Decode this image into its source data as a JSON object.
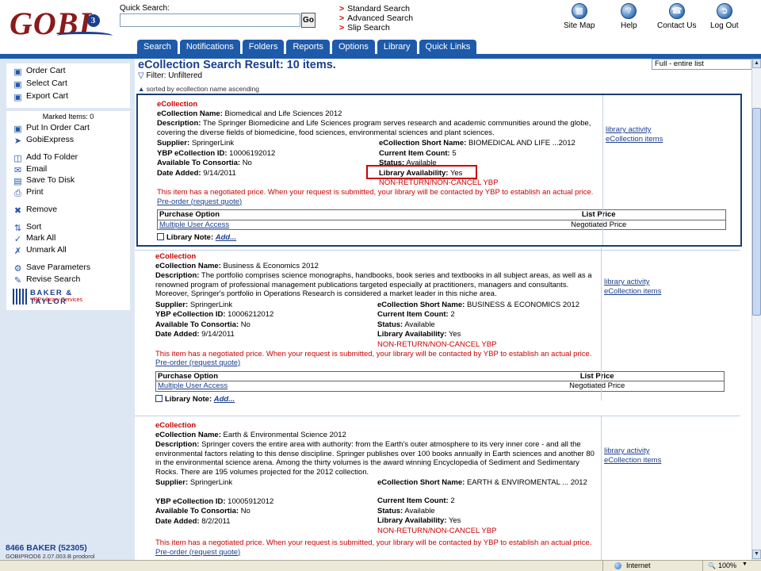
{
  "header": {
    "logo_text": "GOBI",
    "logo_version": "3",
    "quick_search_label": "Quick Search:",
    "quick_search_value": "",
    "go_label": "Go",
    "search_links": [
      "Standard Search",
      "Advanced Search",
      "Slip Search"
    ],
    "utility_icons": [
      {
        "label": "Site Map",
        "icon": "sitemap-icon"
      },
      {
        "label": "Help",
        "icon": "help-icon"
      },
      {
        "label": "Contact Us",
        "icon": "contact-icon"
      },
      {
        "label": "Log Out",
        "icon": "logout-icon"
      }
    ]
  },
  "tabs": [
    "Search",
    "Notifications",
    "Folders",
    "Reports",
    "Options",
    "Library",
    "Quick Links"
  ],
  "sidebar": {
    "cart_actions": [
      {
        "label": "Order Cart",
        "icon": "cart-icon"
      },
      {
        "label": "Select Cart",
        "icon": "cart-icon"
      },
      {
        "label": "Export Cart",
        "icon": "cart-icon"
      }
    ],
    "marked_items": "Marked Items: 0",
    "item_actions": [
      {
        "label": "Put In Order Cart",
        "icon": "cart-icon",
        "group": 0
      },
      {
        "label": "GobiExpress",
        "icon": "express-icon",
        "group": 0
      },
      {
        "label": "Add To Folder",
        "icon": "folder-icon",
        "group": 1
      },
      {
        "label": "Email",
        "icon": "email-icon",
        "group": 1
      },
      {
        "label": "Save To Disk",
        "icon": "disk-icon",
        "group": 1
      },
      {
        "label": "Print",
        "icon": "print-icon",
        "group": 1
      },
      {
        "label": "Remove",
        "icon": "remove-icon",
        "group": 2
      },
      {
        "label": "Sort",
        "icon": "sort-icon",
        "group": 3
      },
      {
        "label": "Mark All",
        "icon": "check-icon",
        "group": 3
      },
      {
        "label": "Unmark All",
        "icon": "uncheck-icon",
        "group": 3
      },
      {
        "label": "Save Parameters",
        "icon": "save-params-icon",
        "group": 4
      },
      {
        "label": "Revise Search",
        "icon": "revise-icon",
        "group": 4
      }
    ],
    "partner_logo": {
      "name": "BAKER & TAYLOR",
      "sub": "YBP Library Services"
    },
    "account": "8466 BAKER (52305)",
    "server": "GOBIPROD6 2.07.003.B prodorol"
  },
  "main": {
    "title": "eCollection Search Result: 10 items.",
    "view_option": "Full - entire list",
    "filter": "Filter: Unfiltered",
    "sort_note": "sorted by ecollection name ascending",
    "labels": {
      "name": "eCollection Name:",
      "description": "Description:",
      "supplier": "Supplier:",
      "ybp_id": "YBP eCollection ID:",
      "consortia": "Available To Consortia:",
      "date_added": "Date Added:",
      "short_name": "eCollection Short Name:",
      "item_count": "Current Item Count:",
      "status": "Status:",
      "availability": "Library Availability:",
      "purchase_option": "Purchase Option",
      "list_price": "List Price",
      "library_note": "Library Note:",
      "add": "Add...",
      "negotiated_text": "This item has a negotiated price. When your request is submitted, your library will be contacted by YBP to establish an actual price.",
      "preorder": "Pre-order (request quote)",
      "library_activity": "library activity",
      "ecollection_items": "eCollection items"
    },
    "records": [
      {
        "type": "eCollection",
        "name": "Biomedical and Life Sciences 2012",
        "description": "The Springer Biomedicine and Life Sciences program serves research and academic communities around the globe, covering the diverse fields of biomedicine, food sciences, environmental sciences and plant sciences.",
        "supplier": "SpringerLink",
        "ybp_id": "10006192012",
        "consortia": "No",
        "date_added": "9/14/2011",
        "short_name": "BIOMEDICAL AND LIFE ...2012",
        "item_count": "5",
        "status": "Available",
        "availability": "Yes",
        "nrc": "NON-RETURN/NON-CANCEL YBP",
        "purchase": {
          "option": "Multiple User Access",
          "price": "Negotiated Price"
        }
      },
      {
        "type": "eCollection",
        "name": "Business & Economics 2012",
        "description": "The portfolio comprises science monographs, handbooks, book series and textbooks in all subject areas, as well as a renowned program of professional management publications targeted especially at practitioners, managers and consultants. Moreover, Springer's portfolio in Operations Research is considered a market leader in this niche area.",
        "supplier": "SpringerLink",
        "ybp_id": "10006212012",
        "consortia": "No",
        "date_added": "9/14/2011",
        "short_name": "BUSINESS & ECONOMICS 2012",
        "item_count": "2",
        "status": "Available",
        "availability": "Yes",
        "nrc": "NON-RETURN/NON-CANCEL YBP",
        "purchase": {
          "option": "Multiple User Access",
          "price": "Negotiated Price"
        }
      },
      {
        "type": "eCollection",
        "name": "Earth & Environmental Science 2012",
        "description": "Springer covers the entire area with authority: from the Earth's outer atmosphere to its very inner core - and all the environmental factors relating to this dense discipline. Springer publishes over 100 books annually in Earth sciences and another 80 in the environmental science arena. Among the thirty volumes is the award winning Encyclopedia of Sediment and Sedimentary Rocks. There are 195 volumes projected for the 2012 collection.",
        "supplier": "SpringerLink",
        "ybp_id": "10005912012",
        "consortia": "No",
        "date_added": "8/2/2011",
        "short_name": "EARTH & ENVIROMENTAL ... 2012",
        "item_count": "2",
        "status": "Available",
        "availability": "Yes",
        "nrc": "NON-RETURN/NON-CANCEL YBP",
        "purchase": {
          "option": "",
          "price": ""
        }
      }
    ]
  },
  "statusbar": {
    "zone": "Internet",
    "zoom": "100%"
  },
  "colors": {
    "brand_blue": "#1d5aaa",
    "logo_red": "#8b1a1a",
    "alert_red": "#cc0000",
    "link_blue": "#1a3f8f",
    "sidebar_bg": "#dde7f4"
  }
}
